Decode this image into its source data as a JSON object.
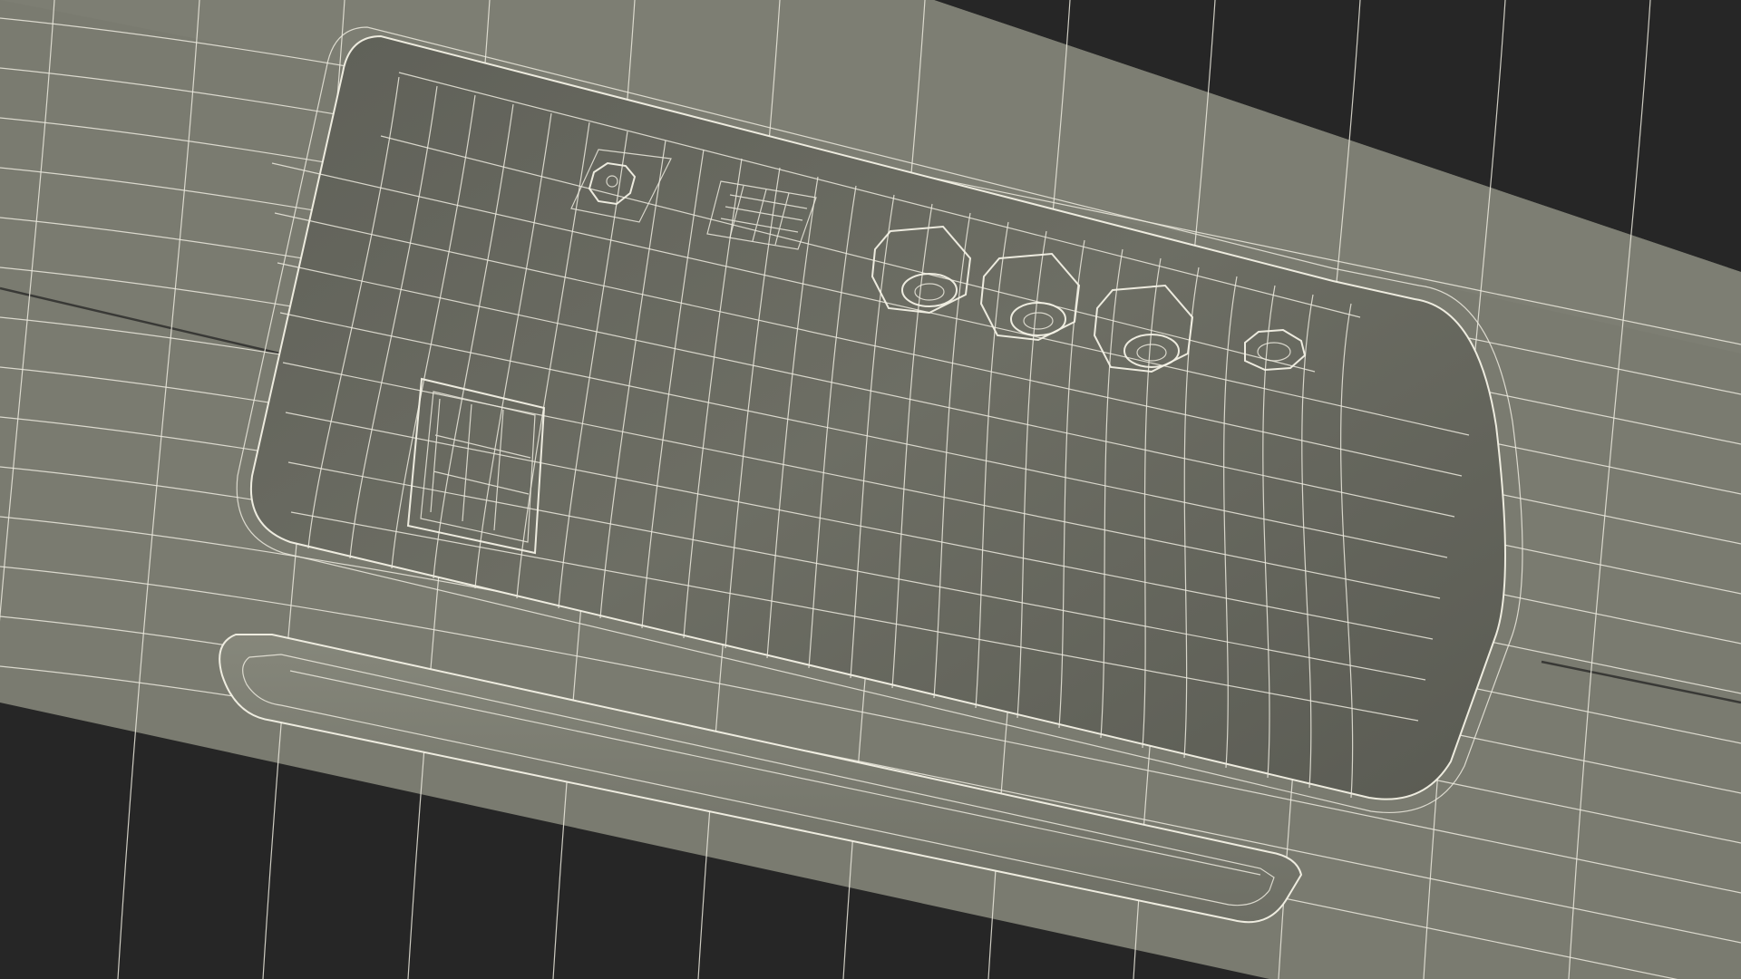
{
  "scene": {
    "background_color": "#262626",
    "surface_color": "#7a7b70",
    "recess_color": "#6b6c62",
    "wire_color": "#eceade",
    "port_inner_color": "#3e3f39"
  }
}
